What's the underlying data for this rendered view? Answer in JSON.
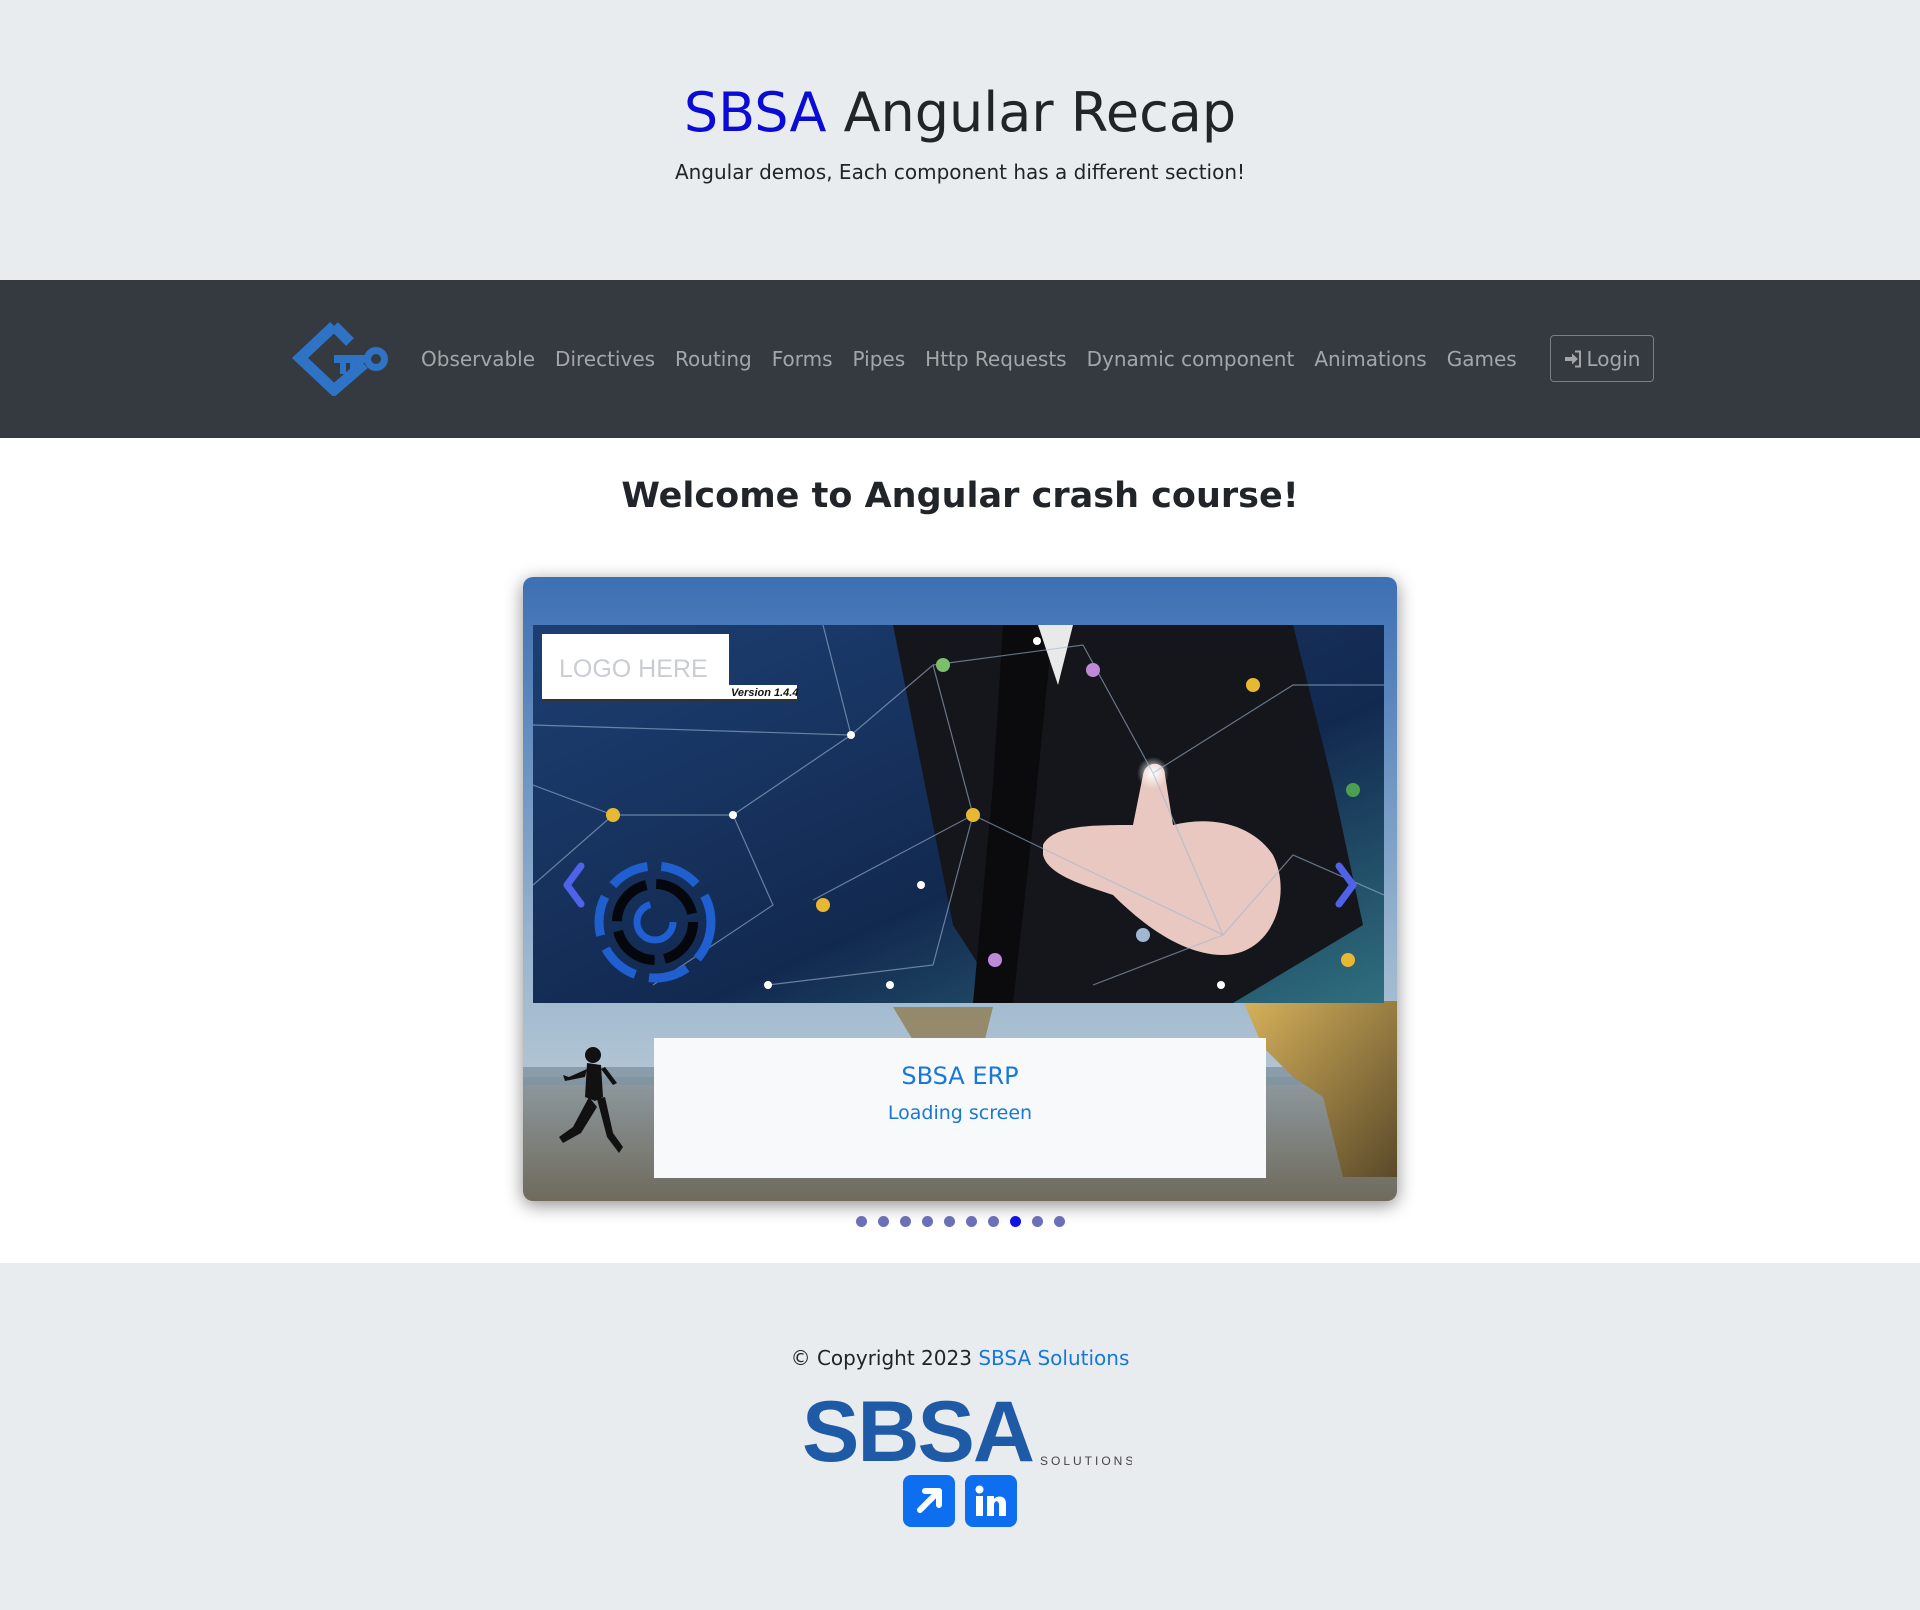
{
  "hero": {
    "brand": "SBSA",
    "title_rest": " Angular Recap",
    "subtitle": "Angular demos, Each component has a different section!"
  },
  "navbar": {
    "logo_icon": "key-diamond-logo-icon",
    "links": [
      {
        "label": "Observable"
      },
      {
        "label": "Directives"
      },
      {
        "label": "Routing"
      },
      {
        "label": "Forms"
      },
      {
        "label": "Pipes"
      },
      {
        "label": "Http Requests"
      },
      {
        "label": "Dynamic component"
      },
      {
        "label": "Animations"
      },
      {
        "label": "Games"
      }
    ],
    "login_label": "Login",
    "login_icon": "sign-in-icon"
  },
  "main": {
    "welcome": "Welcome to Angular crash course!",
    "carousel": {
      "slide_image": {
        "logo_placeholder": "LOGO HERE",
        "version": "Version 1.4.4"
      },
      "caption_title": "SBSA ERP",
      "caption_text": "Loading screen",
      "prev_icon": "chevron-left-icon",
      "next_icon": "chevron-right-icon",
      "slide_count": 10,
      "active_index": 7
    }
  },
  "footer": {
    "copyright_prefix": "© Copyright 2023 ",
    "company_link": "SBSA Solutions",
    "logo_text": "SBSA",
    "logo_sub": "SOLUTIONS",
    "social": [
      {
        "name": "external-link-icon"
      },
      {
        "name": "linkedin-icon"
      }
    ],
    "colors": {
      "brand_blue": "#0b0bd6",
      "link_blue": "#1977d8",
      "logo_blue": "#1f5aa6",
      "navbar_bg": "#343a40",
      "band_bg": "#e9ecef"
    }
  }
}
